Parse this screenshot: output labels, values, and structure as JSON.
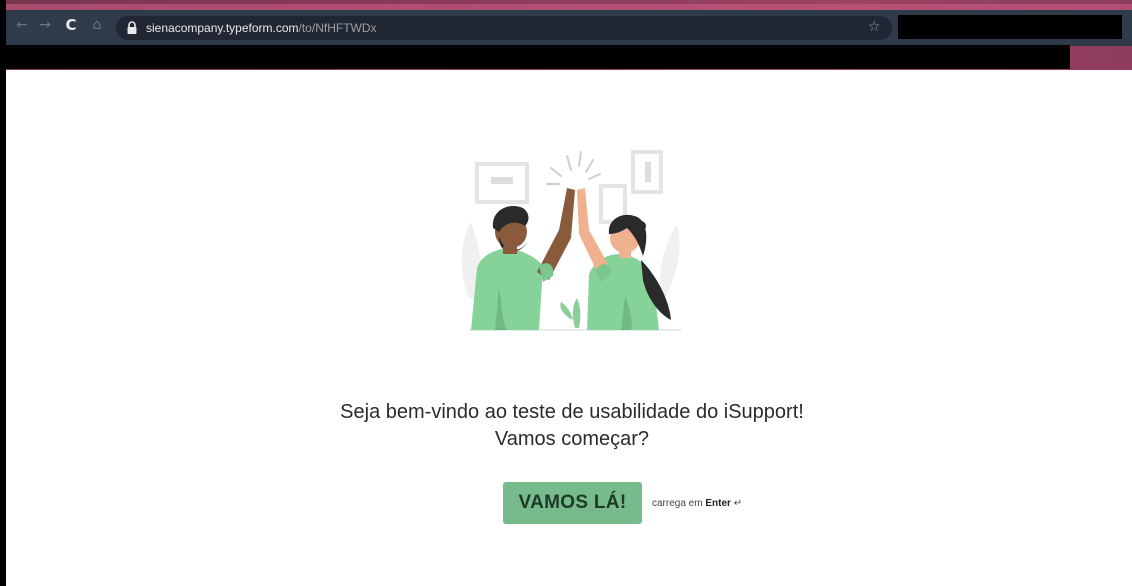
{
  "browser": {
    "url_domain": "sienacompany.typeform.com",
    "url_path": "/to/NfHFTWDx"
  },
  "page": {
    "welcome_line1": "Seja bem-vindo ao teste de usabilidade do iSupport!",
    "welcome_line2": "Vamos começar?",
    "start_button_label": "VAMOS LÁ!",
    "hint_prefix": "carrega em",
    "hint_key": "Enter",
    "hint_symbol": "↵"
  },
  "icons": {
    "back": "arrow-left-icon",
    "forward": "arrow-right-icon",
    "reload": "reload-icon",
    "home": "home-icon",
    "lock": "lock-icon",
    "bookmark": "star-icon"
  },
  "colors": {
    "button_bg": "#77ba8c",
    "button_text": "#1d3a27",
    "chrome_accent": "#8b3a5a",
    "illustration_green": "#86d39a"
  }
}
